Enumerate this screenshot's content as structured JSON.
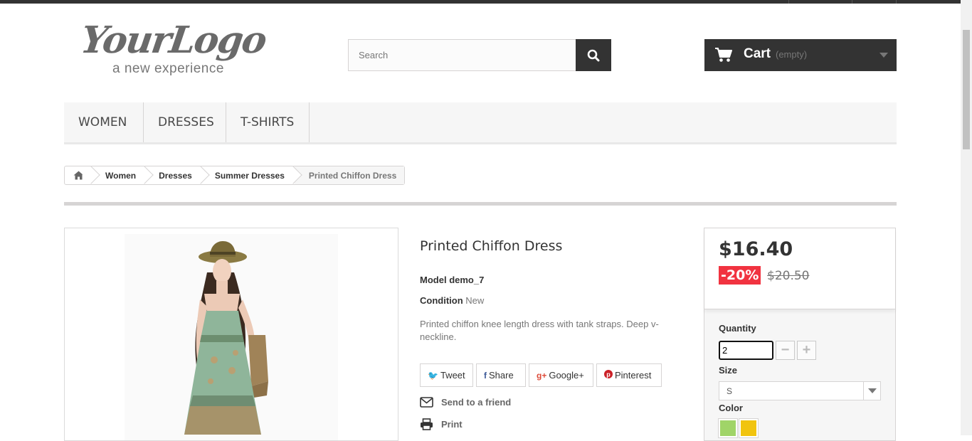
{
  "header": {
    "logo_main": "YourLogo",
    "logo_tagline": "a new experience",
    "search_placeholder": "Search",
    "cart_label": "Cart",
    "cart_status": "(empty)"
  },
  "nav": {
    "items": [
      {
        "label": "WOMEN"
      },
      {
        "label": "DRESSES"
      },
      {
        "label": "T-SHIRTS"
      }
    ]
  },
  "breadcrumb": {
    "items": [
      "Women",
      "Dresses",
      "Summer Dresses",
      "Printed Chiffon Dress"
    ]
  },
  "product": {
    "title": "Printed Chiffon Dress",
    "model_label": "Model",
    "model_value": "demo_7",
    "condition_label": "Condition",
    "condition_value": "New",
    "description": "Printed chiffon knee length dress with tank straps. Deep v-neckline.",
    "social": {
      "tweet": "Tweet",
      "share": "Share",
      "google": "Google+",
      "pinterest": "Pinterest"
    },
    "send_to_friend": "Send to a friend",
    "print": "Print"
  },
  "buy_box": {
    "price": "$16.40",
    "discount": "-20%",
    "old_price": "$20.50",
    "quantity_label": "Quantity",
    "quantity_value": "2",
    "size_label": "Size",
    "size_selected": "S",
    "color_label": "Color",
    "colors": [
      "#a0d468",
      "#f1c40f"
    ]
  }
}
